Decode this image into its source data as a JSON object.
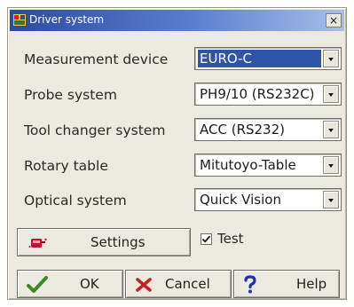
{
  "window": {
    "title": "Driver system",
    "close_glyph": "×"
  },
  "fields": [
    {
      "label": "Measurement device",
      "value": "EURO-C",
      "selected": true
    },
    {
      "label": "Probe system",
      "value": "PH9/10 (RS232C)"
    },
    {
      "label": "Tool changer system",
      "value": "ACC (RS232)"
    },
    {
      "label": "Rotary table",
      "value": "Mitutoyo-Table"
    },
    {
      "label": "Optical system",
      "value": "Quick Vision"
    }
  ],
  "settings_button": {
    "label": "Settings",
    "icon": "settings-icon"
  },
  "test_checkbox": {
    "label": "Test",
    "checked": true
  },
  "buttons": {
    "ok": {
      "label": "OK",
      "icon": "checkmark-icon"
    },
    "cancel": {
      "label": "Cancel",
      "icon": "cross-icon"
    },
    "help": {
      "label": "Help",
      "icon": "question-mark-icon"
    }
  },
  "colors": {
    "title_bar": "#2c4a9e",
    "selection": "#2f55a8",
    "ok_icon": "#3c8a1f",
    "cancel_icon": "#c41e1e",
    "help_icon": "#1f35b0",
    "settings_icon": "#c8102e"
  }
}
